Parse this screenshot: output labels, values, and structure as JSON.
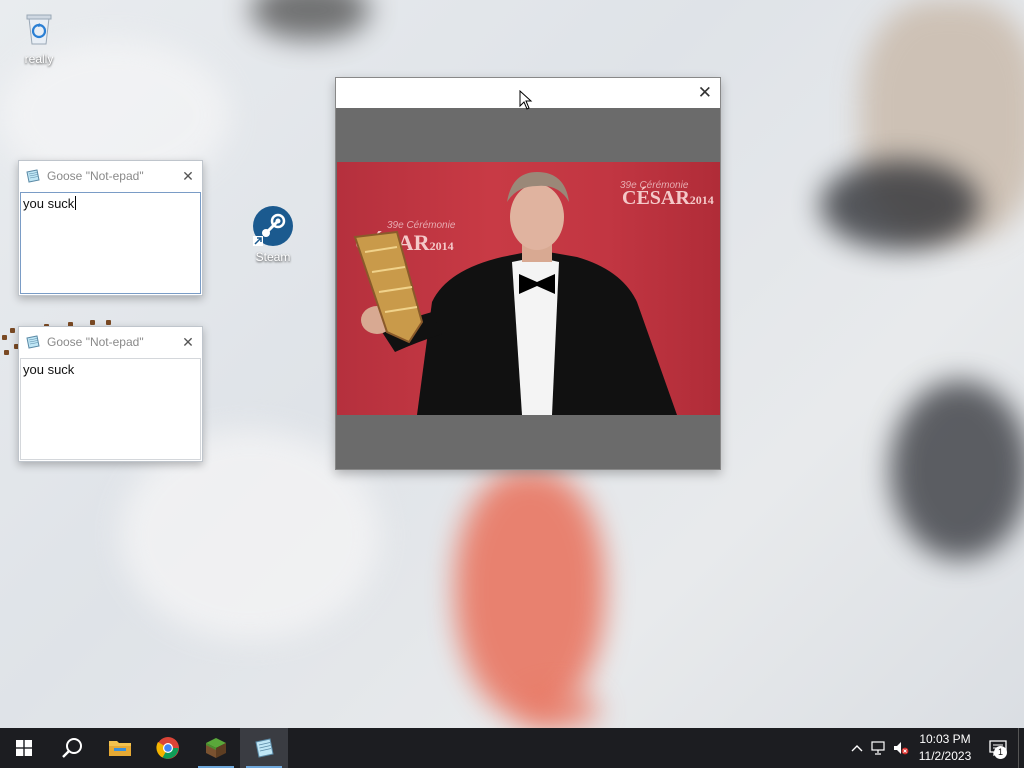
{
  "desktop": {
    "icons": [
      {
        "label": "really",
        "icon": "recycle-bin-icon"
      },
      {
        "label": "Steam",
        "icon": "steam-icon"
      }
    ]
  },
  "notepads": [
    {
      "title": "Goose \"Not-epad\"",
      "text": "you suck",
      "focused": true
    },
    {
      "title": "Goose \"Not-epad\"",
      "text": "you suck",
      "focused": false
    }
  ],
  "image_window": {
    "close_label": "✕",
    "photo": {
      "description_icon": "photo-image",
      "brand_text_1": "CÉSAR",
      "brand_year_1": "2014",
      "brand_text_2": "CÉSAR",
      "brand_year_2": "2014",
      "brand_sub": "39e Cérémonie",
      "colors": {
        "backdrop": "#c23642",
        "tux": "#111111"
      }
    }
  },
  "taskbar": {
    "apps": [
      {
        "name": "start-button",
        "icon": "windows-logo-icon"
      },
      {
        "name": "search-button",
        "icon": "search-icon"
      },
      {
        "name": "file-explorer",
        "icon": "folder-icon"
      },
      {
        "name": "chrome",
        "icon": "chrome-icon"
      },
      {
        "name": "minecraft",
        "icon": "grass-block-icon"
      },
      {
        "name": "notepad",
        "icon": "notepad-icon",
        "active": true
      }
    ],
    "tray": {
      "time": "10:03 PM",
      "date": "11/2/2023",
      "notification_count": "1"
    }
  },
  "colors": {
    "taskbar_bg": "#1c1d21",
    "notepad_focus_border": "#7a9cc6",
    "image_window_bg": "#6b6b6b"
  }
}
